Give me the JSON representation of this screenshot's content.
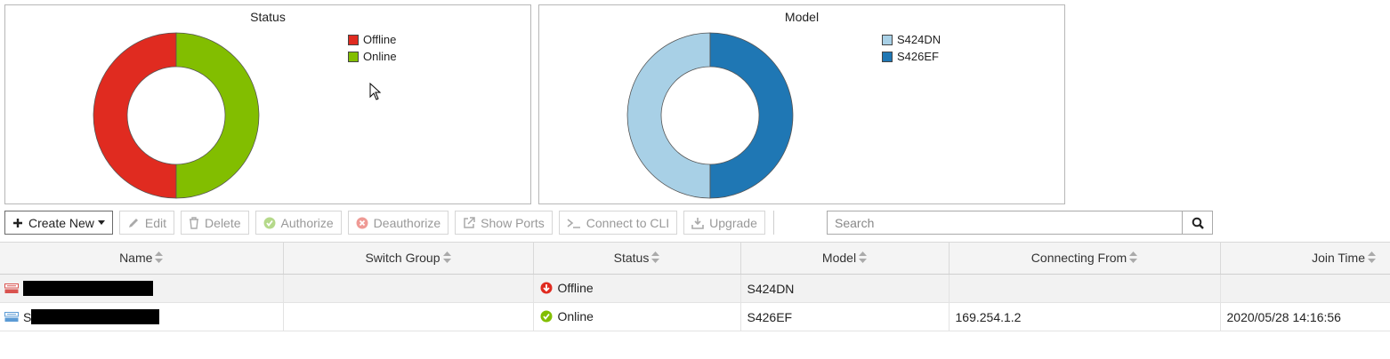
{
  "charts": {
    "status": {
      "title": "Status",
      "legend": [
        {
          "label": "Offline",
          "color": "#e02b20"
        },
        {
          "label": "Online",
          "color": "#82be00"
        }
      ]
    },
    "model": {
      "title": "Model",
      "legend": [
        {
          "label": "S424DN",
          "color": "#a8d0e6"
        },
        {
          "label": "S426EF",
          "color": "#1f77b4"
        }
      ]
    }
  },
  "chart_data": [
    {
      "type": "pie",
      "title": "Status",
      "categories": [
        "Offline",
        "Online"
      ],
      "values": [
        1,
        1
      ],
      "colors": [
        "#e02b20",
        "#82be00"
      ],
      "legend": "top-right"
    },
    {
      "type": "pie",
      "title": "Model",
      "categories": [
        "S424DN",
        "S426EF"
      ],
      "values": [
        1,
        1
      ],
      "colors": [
        "#a8d0e6",
        "#1f77b4"
      ],
      "legend": "top-right"
    }
  ],
  "toolbar": {
    "create_new": "Create New",
    "edit": "Edit",
    "delete": "Delete",
    "authorize": "Authorize",
    "deauthorize": "Deauthorize",
    "show_ports": "Show Ports",
    "connect_cli": "Connect to CLI",
    "upgrade": "Upgrade",
    "search_placeholder": "Search"
  },
  "table": {
    "columns": [
      "Name",
      "Switch Group",
      "Status",
      "Model",
      "Connecting From",
      "Join Time"
    ],
    "rows": [
      {
        "name_prefix": "",
        "group": "",
        "status": "Offline",
        "model": "S424DN",
        "from": "",
        "join": ""
      },
      {
        "name_prefix": "S",
        "group": "",
        "status": "Online",
        "model": "S426EF",
        "from": "169.254.1.2",
        "join": "2020/05/28 14:16:56"
      }
    ]
  },
  "colors": {
    "offline": "#e02b20",
    "online": "#82be00",
    "switch_offline_icon": "#d9534f",
    "switch_online_icon": "#5b9bd5"
  }
}
